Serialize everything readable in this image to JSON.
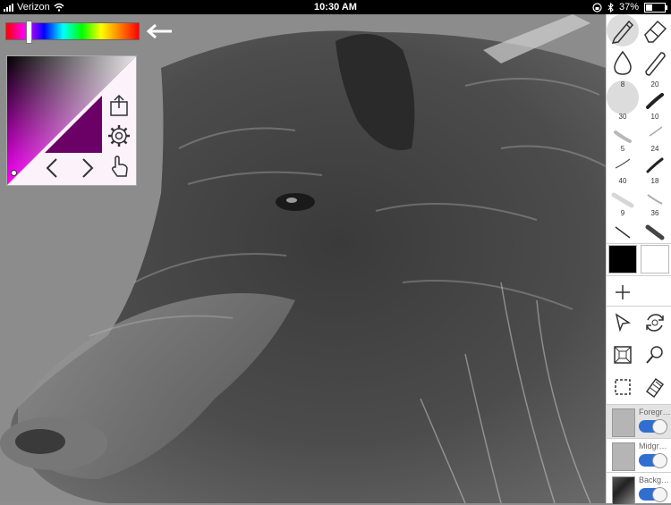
{
  "status_bar": {
    "carrier": "Verizon",
    "time": "10:30 AM",
    "battery": "37%",
    "battery_level": 0.37
  },
  "color": {
    "primary": "#000000",
    "secondary": "#ffffff",
    "picked": "#6b0066",
    "hue_position": 0.17
  },
  "brush_sizes": [
    "8",
    "20",
    "30",
    "10",
    "5",
    "24",
    "40",
    "18",
    "9",
    "36"
  ],
  "selected_brush_size": "8",
  "layers": [
    {
      "name": "Foreground",
      "visible": true,
      "selected": true
    },
    {
      "name": "Midground",
      "visible": true,
      "selected": false
    },
    {
      "name": "Background",
      "visible": true,
      "selected": false
    }
  ],
  "icons": {
    "tools": [
      "pencil-icon",
      "eraser-icon",
      "smudge-drop-icon",
      "airbrush-icon"
    ],
    "actions": [
      "cursor-icon",
      "rotate-icon",
      "fit-icon",
      "zoom-icon",
      "select-icon",
      "reference-icon"
    ],
    "color_panel": [
      "export-icon",
      "gear-icon",
      "undo-icon",
      "redo-icon",
      "touch-icon"
    ]
  }
}
